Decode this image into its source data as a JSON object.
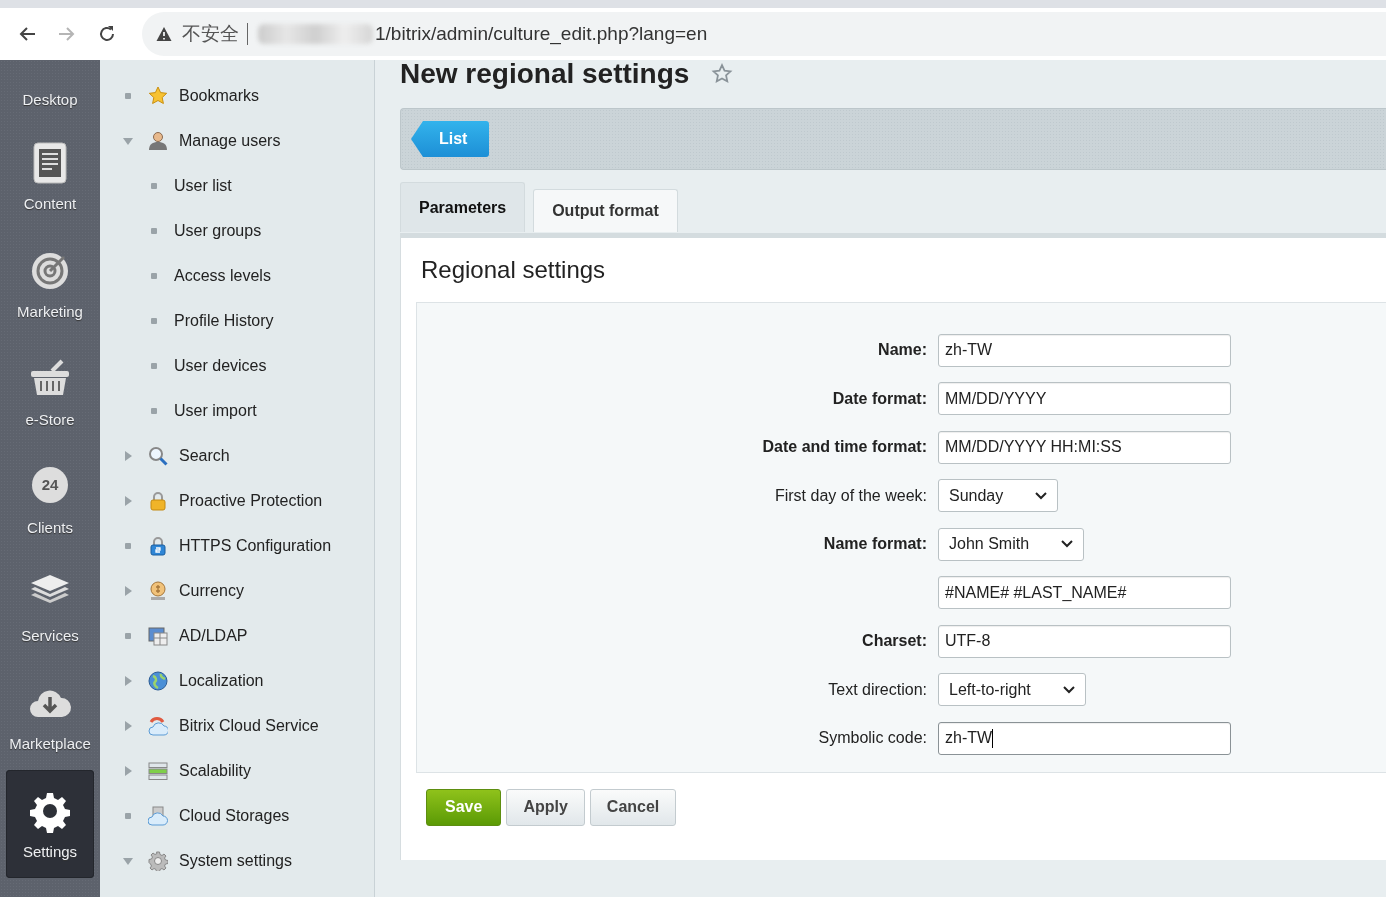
{
  "browser": {
    "navigation": [
      {
        "disabled": false
      },
      {
        "disabled": true
      },
      {
        "disabled": false
      }
    ],
    "address_bar": {
      "security_label": "不安全",
      "url": "1/bitrix/admin/culture_edit.php?lang=en"
    }
  },
  "rail": [
    {
      "label": "Desktop",
      "selected": false
    },
    {
      "label": "Content",
      "selected": false
    },
    {
      "label": "Marketing",
      "selected": false
    },
    {
      "label": "e-Store",
      "selected": false
    },
    {
      "label": "Clients",
      "selected": false,
      "icon_text": "24"
    },
    {
      "label": "Services",
      "selected": false
    },
    {
      "label": "Marketplace",
      "selected": false
    },
    {
      "label": "Settings",
      "selected": true
    }
  ],
  "menu": [
    {
      "label": "Bookmarks",
      "kind": "leaf"
    },
    {
      "label": "Manage users",
      "kind": "folder",
      "expanded": true,
      "children": [
        {
          "label": "User list"
        },
        {
          "label": "User groups"
        },
        {
          "label": "Access levels"
        },
        {
          "label": "Profile History"
        },
        {
          "label": "User devices"
        },
        {
          "label": "User import"
        }
      ]
    },
    {
      "label": "Search",
      "kind": "folder",
      "expanded": false
    },
    {
      "label": "Proactive Protection",
      "kind": "folder",
      "expanded": false
    },
    {
      "label": "HTTPS Configuration",
      "kind": "leaf"
    },
    {
      "label": "Currency",
      "kind": "folder",
      "expanded": false
    },
    {
      "label": "AD/LDAP",
      "kind": "leaf"
    },
    {
      "label": "Localization",
      "kind": "folder",
      "expanded": false
    },
    {
      "label": "Bitrix Cloud Service",
      "kind": "folder",
      "expanded": false
    },
    {
      "label": "Scalability",
      "kind": "folder",
      "expanded": false
    },
    {
      "label": "Cloud Storages",
      "kind": "leaf"
    },
    {
      "label": "System settings",
      "kind": "folder",
      "expanded": true
    }
  ],
  "page": {
    "title": "New regional settings",
    "toolbar": {
      "list_button": "List"
    },
    "tabs": [
      {
        "label": "Parameters",
        "selected": true
      },
      {
        "label": "Output format",
        "selected": false
      }
    ],
    "section_title": "Regional settings",
    "fields": [
      {
        "label": "Name:",
        "bold": true,
        "kind": "text",
        "value": "zh-TW",
        "focused": false
      },
      {
        "label": "Date format:",
        "bold": true,
        "kind": "text",
        "value": "MM/DD/YYYY",
        "focused": false
      },
      {
        "label": "Date and time format:",
        "bold": true,
        "kind": "text",
        "value": "MM/DD/YYYY HH:MI:SS",
        "focused": false
      },
      {
        "label": "First day of the week:",
        "bold": false,
        "kind": "select",
        "value": "Sunday",
        "focused": false
      },
      {
        "label": "Name format:",
        "bold": true,
        "kind": "select",
        "value": "John Smith",
        "focused": false
      },
      {
        "kind": "text",
        "value": "#NAME# #LAST_NAME#",
        "focused": false
      },
      {
        "label": "Charset:",
        "bold": true,
        "kind": "text",
        "value": "UTF-8",
        "focused": false
      },
      {
        "label": "Text direction:",
        "bold": false,
        "kind": "select",
        "value": "Left-to-right",
        "focused": false
      },
      {
        "label": "Symbolic code:",
        "bold": false,
        "kind": "text",
        "value": "zh-TW",
        "focused": true
      }
    ],
    "buttons": [
      {
        "label": "Save",
        "kind": "primary"
      },
      {
        "label": "Apply",
        "kind": "secondary"
      },
      {
        "label": "Cancel",
        "kind": "secondary"
      }
    ]
  }
}
